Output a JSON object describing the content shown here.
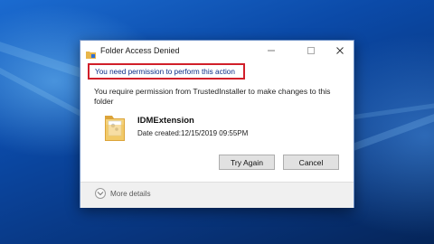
{
  "dialog": {
    "title": "Folder Access Denied",
    "heading": "You need permission to perform this action",
    "message": "You require permission from TrustedInstaller to make changes to this folder",
    "folder": {
      "name": "IDMExtension",
      "date_created": "Date created:12/15/2019 09:55PM"
    },
    "buttons": {
      "try_again": "Try Again",
      "cancel": "Cancel"
    },
    "more_details": "More details",
    "colors": {
      "highlight_border": "#d11f2a",
      "heading_text": "#0b2c86"
    }
  },
  "icons": {
    "title_icon": "folder-shield-icon",
    "folder_icon": "folder-icon",
    "expand_icon": "chevron-down-icon"
  }
}
